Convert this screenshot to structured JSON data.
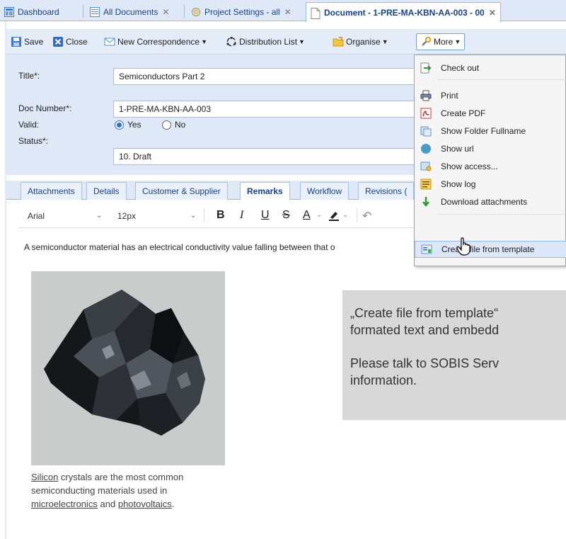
{
  "tabs": [
    {
      "label": "Dashboard",
      "icon": "dashboard-icon",
      "closable": false,
      "active": false
    },
    {
      "label": "All Documents",
      "icon": "documents-icon",
      "closable": true,
      "active": false
    },
    {
      "label": "Project Settings - all",
      "icon": "settings-icon",
      "closable": true,
      "active": false
    },
    {
      "label": "Document - 1-PRE-MA-KBN-AA-003 - 00",
      "icon": "document-icon",
      "closable": true,
      "active": true
    }
  ],
  "toolbar": {
    "save": "Save",
    "close": "Close",
    "new_correspondence": "New Correspondence",
    "distribution_list": "Distribution List",
    "organise": "Organise",
    "more": "More"
  },
  "form": {
    "title_label": "Title*:",
    "title_value": "Semiconductors Part 2",
    "docnum_label": "Doc Number*:",
    "docnum_value": "1-PRE-MA-KBN-AA-003",
    "valid_label": "Valid:",
    "valid_yes": "Yes",
    "valid_no": "No",
    "valid_selected": "Yes",
    "status_label": "Status*:",
    "status_value": "10. Draft"
  },
  "content_tabs": [
    "Attachments",
    "Details",
    "Customer & Supplier",
    "Remarks",
    "Workflow",
    "Revisions ("
  ],
  "active_content_tab": "Remarks",
  "editor": {
    "font": "Arial",
    "size": "12px",
    "bold": "B",
    "italic": "I",
    "underline": "U",
    "strike": "S",
    "color": "A",
    "paragraph": "A semiconductor material has an electrical conductivity value falling between that o",
    "caption_link1": "Silicon",
    "caption_text1": " crystals are the most common semiconducting materials used in ",
    "caption_link2": "microelectronics",
    "caption_text2": " and ",
    "caption_link3": "photovoltaics",
    "caption_text3": "."
  },
  "menu": {
    "items": [
      {
        "label": "Check out",
        "icon": "checkout-icon"
      },
      {
        "label": "Print",
        "icon": "print-icon"
      },
      {
        "label": "Create PDF",
        "icon": "pdf-icon"
      },
      {
        "label": "Show Folder Fullname",
        "icon": "folder-icon"
      },
      {
        "label": "Show url",
        "icon": "globe-icon"
      },
      {
        "label": "Show access...",
        "icon": "access-icon"
      },
      {
        "label": "Show log",
        "icon": "log-icon"
      },
      {
        "label": "Download attachments",
        "icon": "download-icon"
      },
      {
        "label": "Create file from template",
        "icon": "template-icon"
      }
    ],
    "highlighted": "Create file from template"
  },
  "callout": {
    "line1": "„Create file from template“",
    "line2": "formated text and embedd",
    "line3": "Please talk to SOBIS Serv",
    "line4": "information."
  },
  "colors": {
    "header_bg": "#dfe8f6",
    "tab_text": "#15428b",
    "radio_selected": "#2a6fd6",
    "menu_highlight": "#dce8f8"
  }
}
